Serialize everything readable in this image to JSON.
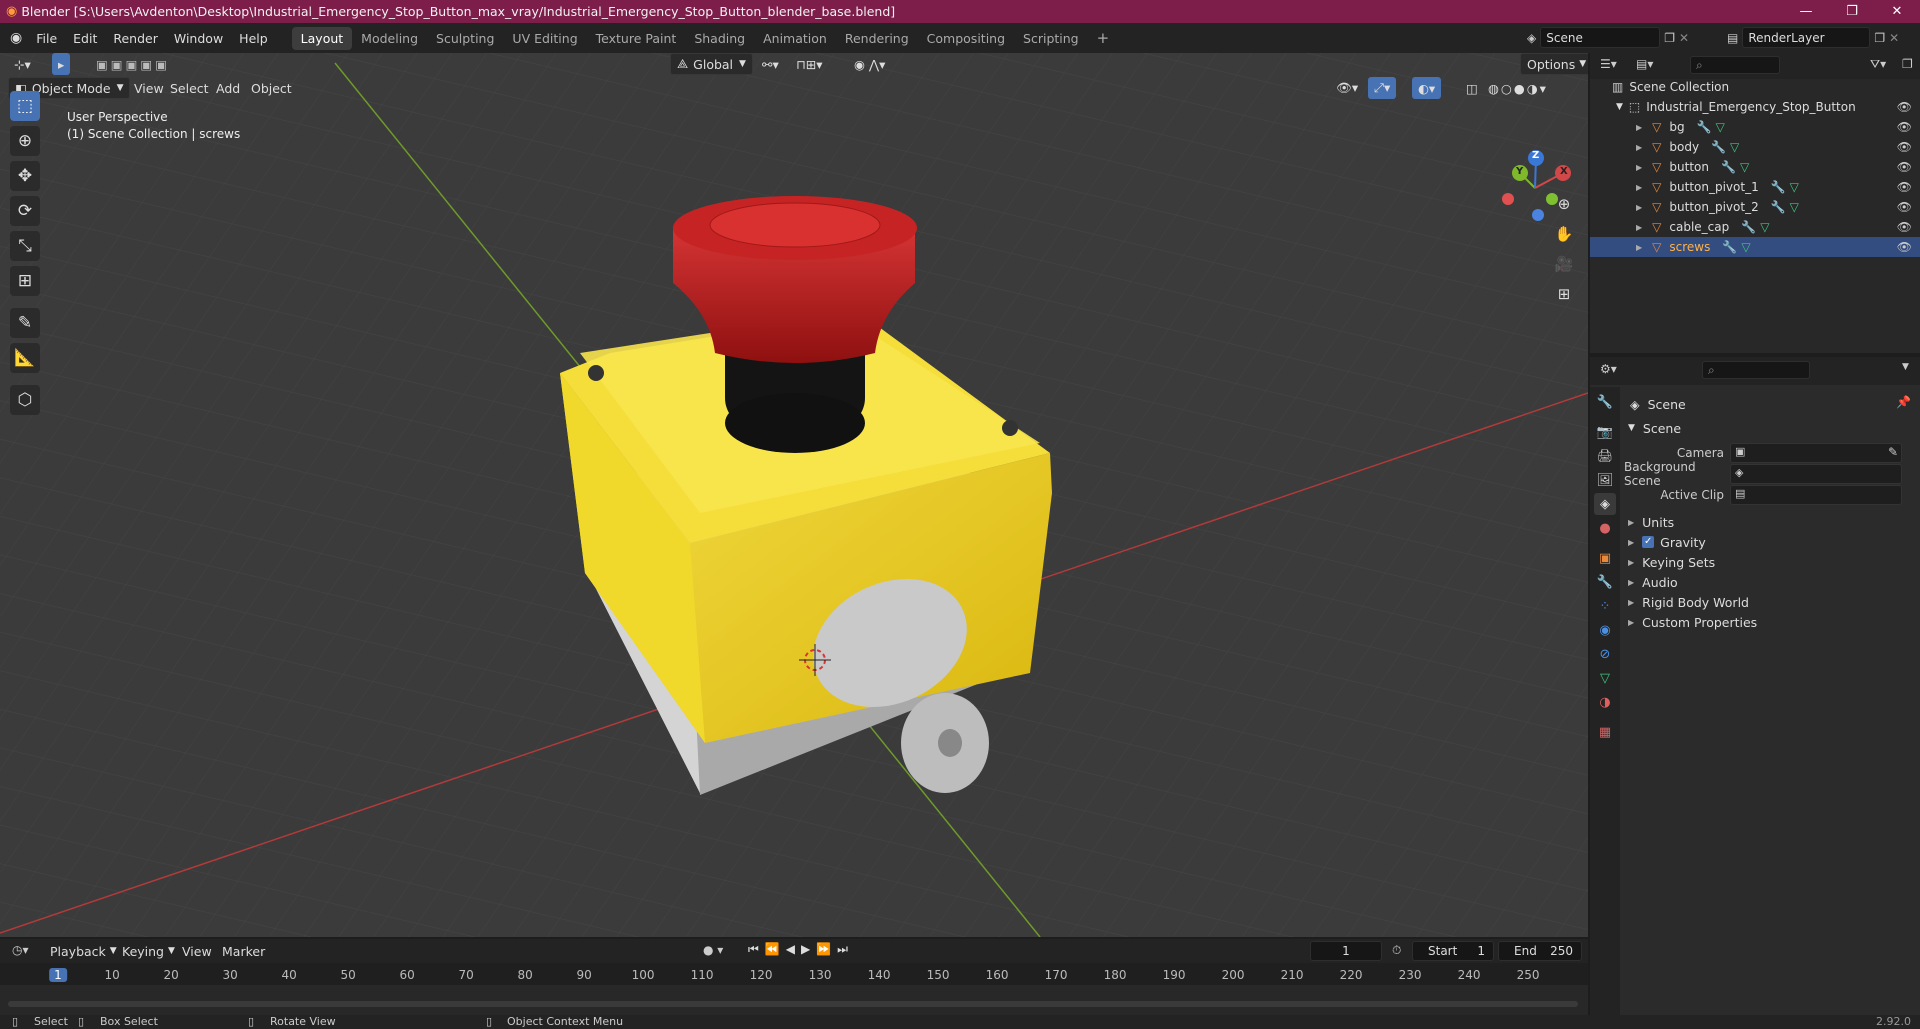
{
  "window": {
    "title": "Blender [S:\\Users\\Avdenton\\Desktop\\Industrial_Emergency_Stop_Button_max_vray/Industrial_Emergency_Stop_Button_blender_base.blend]",
    "minimize": "—",
    "maximize": "❐",
    "close": "✕"
  },
  "menu": [
    "File",
    "Edit",
    "Render",
    "Window",
    "Help"
  ],
  "workspaces": [
    {
      "label": "Layout",
      "active": true
    },
    {
      "label": "Modeling",
      "active": false
    },
    {
      "label": "Sculpting",
      "active": false
    },
    {
      "label": "UV Editing",
      "active": false
    },
    {
      "label": "Texture Paint",
      "active": false
    },
    {
      "label": "Shading",
      "active": false
    },
    {
      "label": "Animation",
      "active": false
    },
    {
      "label": "Rendering",
      "active": false
    },
    {
      "label": "Compositing",
      "active": false
    },
    {
      "label": "Scripting",
      "active": false
    }
  ],
  "scene_field": "Scene",
  "render_layer_field": "RenderLayer",
  "viewport": {
    "transform_orientation": "Global",
    "options_label": "Options",
    "mode": "Object Mode",
    "menus": [
      "View",
      "Select",
      "Add",
      "Object"
    ],
    "overlay_line1": "User Perspective",
    "overlay_line2": "(1) Scene Collection | screws",
    "gizmo": {
      "x": "X",
      "y": "Y",
      "z": "Z"
    }
  },
  "outliner": {
    "root": "Scene Collection",
    "collection": "Industrial_Emergency_Stop_Button",
    "objects": [
      {
        "name": "bg",
        "selected": false
      },
      {
        "name": "body",
        "selected": false
      },
      {
        "name": "button",
        "selected": false
      },
      {
        "name": "button_pivot_1",
        "selected": false
      },
      {
        "name": "button_pivot_2",
        "selected": false
      },
      {
        "name": "cable_cap",
        "selected": false
      },
      {
        "name": "screws",
        "selected": true
      }
    ]
  },
  "properties": {
    "context": "Scene",
    "panel_title": "Scene",
    "fields": [
      {
        "label": "Camera",
        "value": ""
      },
      {
        "label": "Background Scene",
        "value": ""
      },
      {
        "label": "Active Clip",
        "value": ""
      }
    ],
    "panels": [
      {
        "label": "Units",
        "checkbox": false
      },
      {
        "label": "Gravity",
        "checkbox": true
      },
      {
        "label": "Keying Sets",
        "checkbox": false
      },
      {
        "label": "Audio",
        "checkbox": false
      },
      {
        "label": "Rigid Body World",
        "checkbox": false
      },
      {
        "label": "Custom Properties",
        "checkbox": false
      }
    ]
  },
  "timeline": {
    "menus": [
      "Playback",
      "Keying",
      "View",
      "Marker"
    ],
    "current_frame": "1",
    "start_label": "Start",
    "start": "1",
    "end_label": "End",
    "end": "250",
    "ticks": [
      "1",
      "10",
      "20",
      "30",
      "40",
      "50",
      "60",
      "70",
      "80",
      "90",
      "100",
      "110",
      "120",
      "130",
      "140",
      "150",
      "160",
      "170",
      "180",
      "190",
      "200",
      "210",
      "220",
      "230",
      "240",
      "250"
    ]
  },
  "statusbar": {
    "select": "Select",
    "box_select": "Box Select",
    "rotate": "Rotate View",
    "context_menu": "Object Context Menu",
    "version": "2.92.0"
  },
  "colors": {
    "title_bar": "#7c1d4a",
    "selection": "#334d80",
    "active_tool": "#4772b3",
    "axis_x": "#d24848",
    "axis_y": "#7fb82a",
    "object_orange": "#e8883a"
  }
}
